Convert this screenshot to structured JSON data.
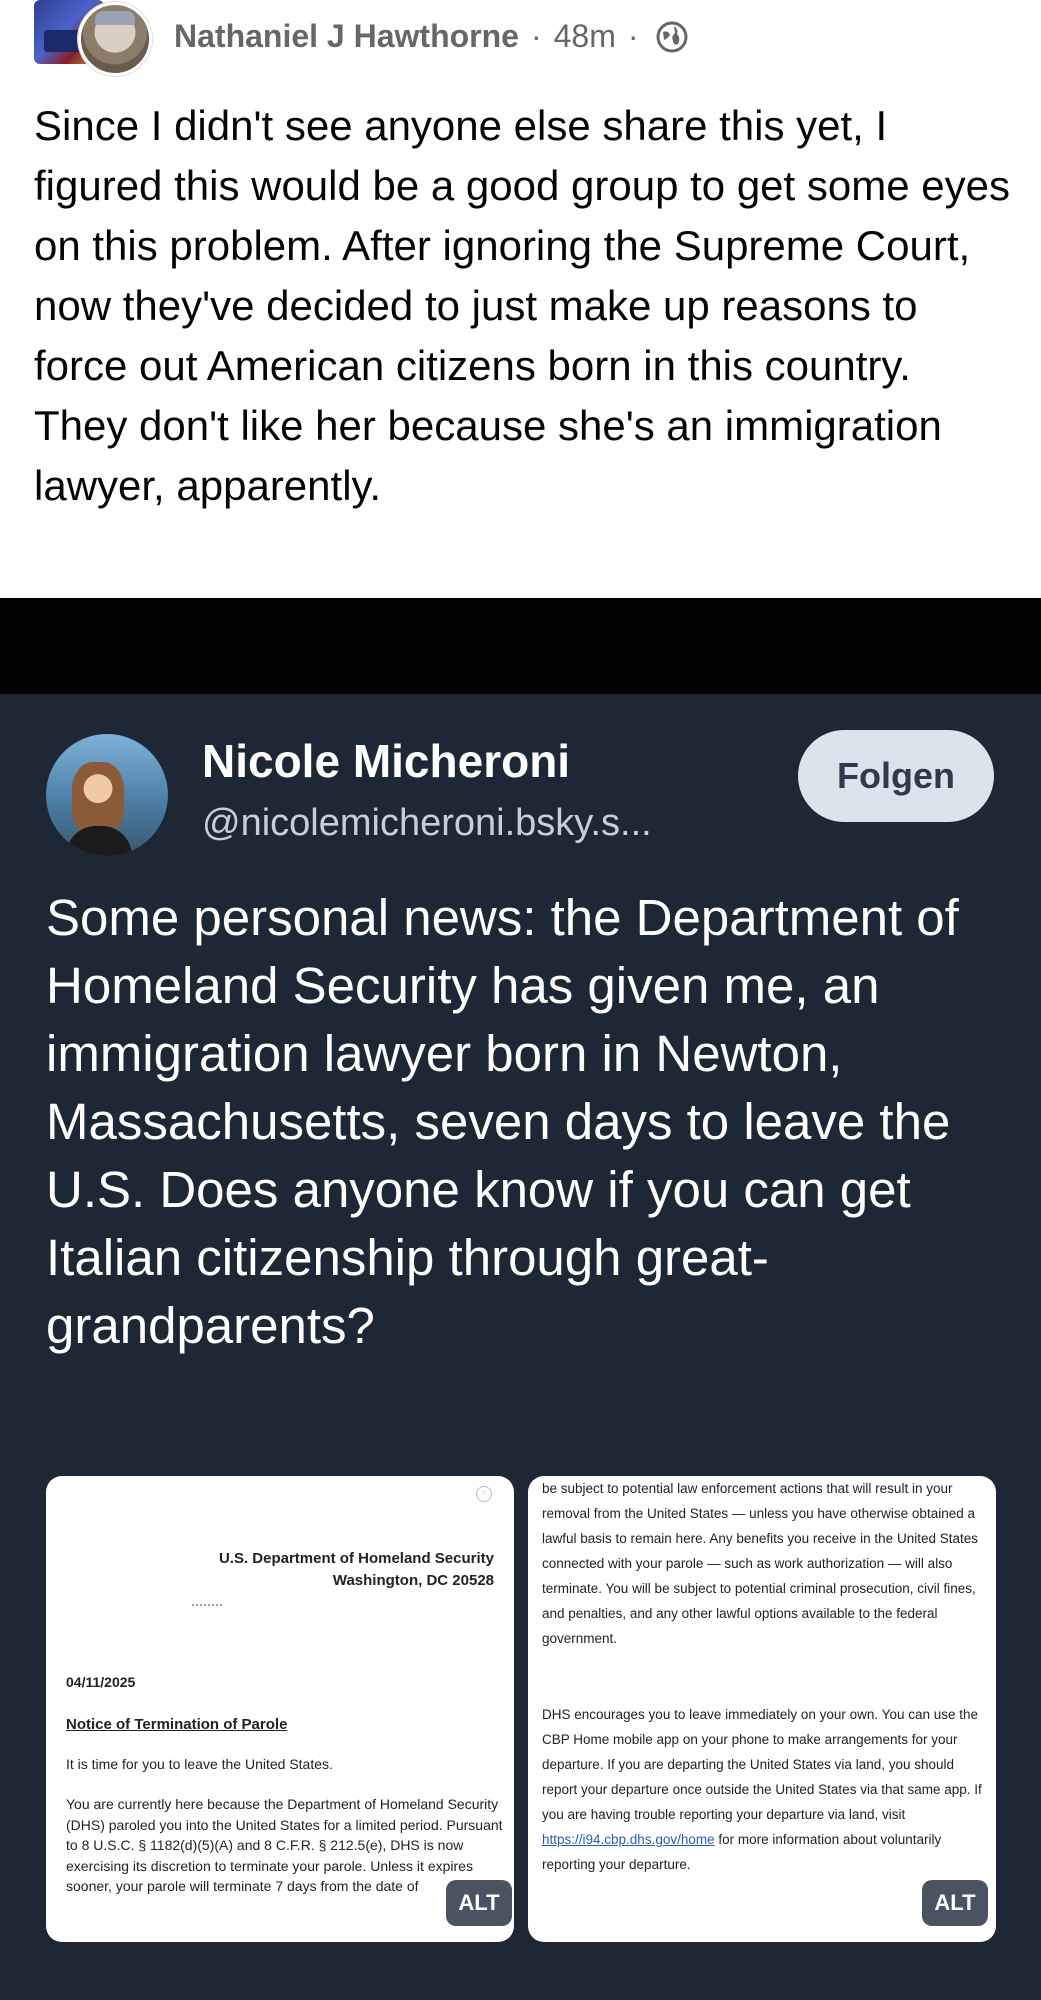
{
  "post": {
    "author": "Nathaniel J Hawthorne",
    "time": "48m",
    "separator": "·",
    "text": "Since I didn't see anyone else share this yet, I figured this would be a good group to get some eyes on this problem. After ignoring the Supreme Court, now they've decided to just make up reasons to force out American citizens born in this country. They don't like her because she's an immigration lawyer, apparently."
  },
  "embed": {
    "name": "Nicole Micheroni",
    "handle": "@nicolemicheroni.bsky.s...",
    "follow_label": "Folgen",
    "text": "Some personal news: the Department of Homeland Security has given me, an immigration lawyer born in Newton, Massachusetts, seven days to leave the U.S. Does anyone know if you can get Italian citizenship through great-grandparents?",
    "alt_label": "ALT"
  },
  "letter": {
    "agency": "U.S. Department of Homeland Security",
    "city": "Washington, DC 20528",
    "date": "04/11/2025",
    "subject": "Notice of Termination of Parole",
    "p1": "It is time for you to leave the United States.",
    "p2": "You are currently here because the Department of Homeland Security (DHS) paroled you into the United States for a limited period. Pursuant to 8 U.S.C. § 1182(d)(5)(A) and 8 C.F.R. § 212.5(e), DHS is now exercising its discretion to terminate your parole. Unless it expires sooner, your parole will terminate 7 days from the date of",
    "r1": "be subject to potential law enforcement actions that will result in your removal from the United States — unless you have otherwise obtained a lawful basis to remain here. Any benefits you receive in the United States connected with your parole — such as work authorization — will also terminate. You will be subject to potential criminal prosecution, civil fines, and penalties, and any other lawful options available to the federal government.",
    "r2_a": "DHS encourages you to leave immediately on your own. You can use the CBP Home mobile app on your phone to make arrangements for your departure. If you are departing the United States via land, you should report your departure once outside the United States via that same app. If you are having trouble reporting your departure via land, visit ",
    "r2_link": "https://i94.cbp.dhs.gov/home",
    "r2_b": " for more information about voluntarily reporting your departure."
  },
  "icons": {
    "globe": "globe-icon",
    "minimize": "circle-icon"
  },
  "colors": {
    "card_bg": "#1e2736",
    "follow_bg": "#dde3ec",
    "meta_gray": "#65676b"
  }
}
